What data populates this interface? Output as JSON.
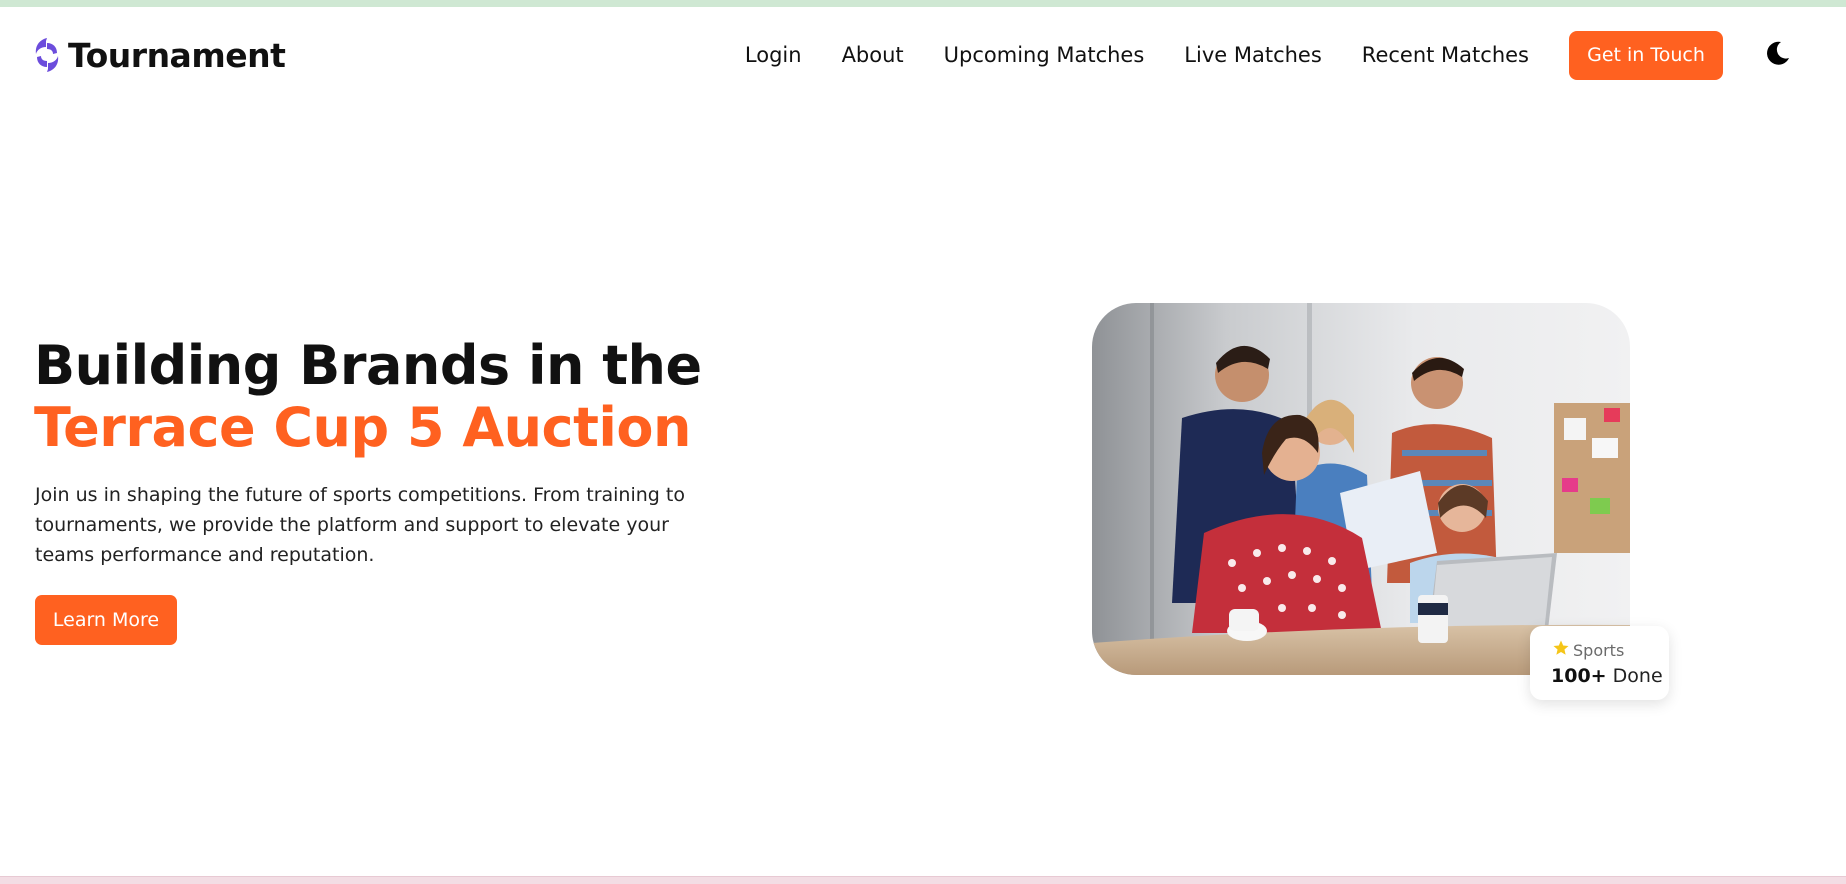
{
  "brand": {
    "name": "Tournament",
    "logo_icon": "brand-swirl-icon",
    "accent_color": "#ff6120",
    "logo_color": "#6c4ddc"
  },
  "nav": {
    "items": [
      {
        "label": "Login"
      },
      {
        "label": "About"
      },
      {
        "label": "Upcoming Matches"
      },
      {
        "label": "Live Matches"
      },
      {
        "label": "Recent Matches"
      }
    ],
    "cta_label": "Get in Touch",
    "theme_toggle_icon": "moon-icon"
  },
  "hero": {
    "title_line1": "Building Brands in the",
    "title_line2": "Terrace Cup 5 Auction",
    "description": "Join us in shaping the future of sports competitions. From training to tournaments, we provide the platform and support to elevate your teams performance and reputation.",
    "button_label": "Learn More",
    "image_alt": "team-collaboration-photo"
  },
  "stat_card": {
    "icon": "star-icon",
    "label": "Sports",
    "number": "100+",
    "suffix": "Done"
  }
}
